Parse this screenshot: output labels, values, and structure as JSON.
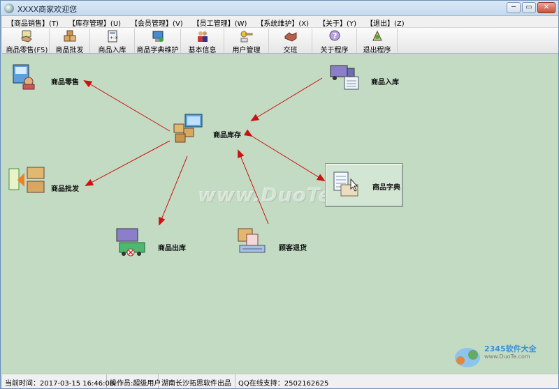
{
  "window": {
    "title": "XXXX商家欢迎您",
    "controls": {
      "minimize": "─",
      "maximize": "▭",
      "close": "✕"
    }
  },
  "menu": [
    "【商品销售】(T)",
    "【库存管理】(U)",
    "【会员管理】(V)",
    "【员工管理】(W)",
    "【系统维护】(X)",
    "【关于】(Y)",
    "【退出】(Z)"
  ],
  "toolbar": [
    {
      "label": "商品零售(F5)",
      "icon": "hand-card-icon"
    },
    {
      "label": "商品批发",
      "icon": "boxes-icon"
    },
    {
      "label": "商品入库",
      "icon": "calculator-icon"
    },
    {
      "label": "商品字典维护",
      "icon": "computer-icon"
    },
    {
      "label": "基本信息",
      "icon": "people-icon"
    },
    {
      "label": "用户管理",
      "icon": "keys-icon"
    },
    {
      "label": "交班",
      "icon": "handshake-icon"
    },
    {
      "label": "关于程序",
      "icon": "question-icon"
    },
    {
      "label": "退出程序",
      "icon": "exit-icon"
    }
  ],
  "diagram": {
    "nodes": {
      "retail": "商品零售",
      "inbound": "商品入库",
      "inventory": "商品库存",
      "wholesale": "商品批发",
      "dictionary": "商品字典",
      "outbound": "商品出库",
      "returns": "顾客退货"
    },
    "arrow_color": "#cc1111"
  },
  "watermark": "www.DuoTe.com",
  "brand": {
    "name": "2345软件大全",
    "url": "www.DuoTe.com"
  },
  "status": {
    "time": "当前时间：2017-03-15 16:46:08",
    "operator": "操作员:超级用户",
    "vendor": "湖南长沙拓思软件出品",
    "support": "QQ在线支持：2502162625"
  }
}
